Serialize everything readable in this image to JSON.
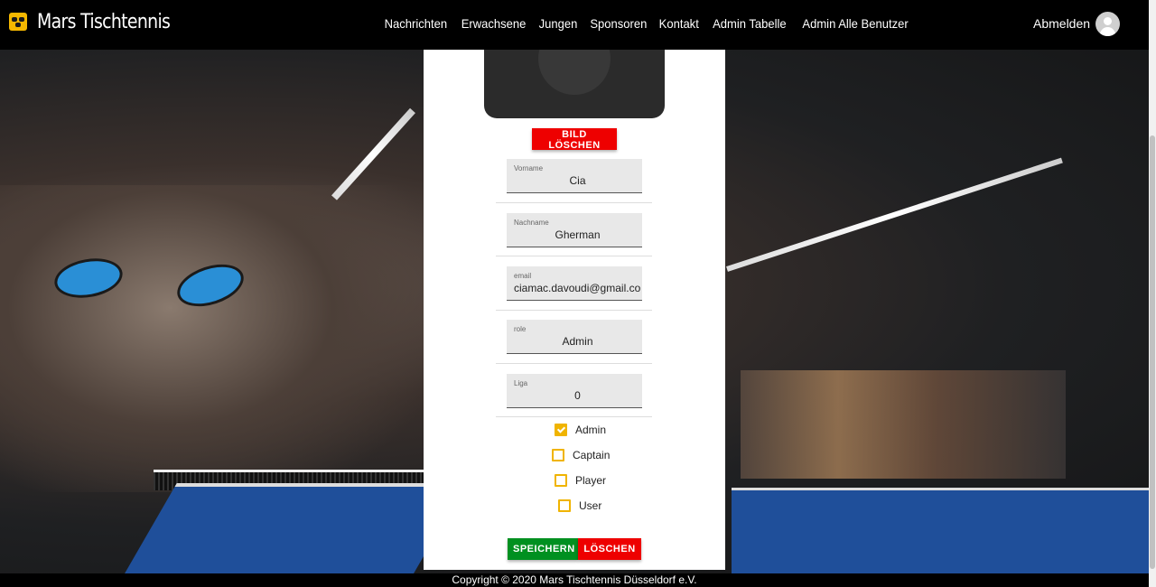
{
  "navbar": {
    "brand": "Mars Tischtennis",
    "links": [
      "Nachrichten",
      "Erwachsene",
      "Jungen",
      "Sponsoren",
      "Kontakt",
      "Admin Tabelle",
      "Admin Alle Benutzer"
    ],
    "logout": "Abmelden",
    "logo_icon": "ping-pong-logo-icon",
    "avatar_icon": "user-avatar-icon"
  },
  "form": {
    "delete_image_label": "Bild löschen",
    "fields": [
      {
        "label": "Vorname",
        "value": "Cia"
      },
      {
        "label": "Nachname",
        "value": "Gherman"
      },
      {
        "label": "email",
        "value": "ciamac.davoudi@gmail.com"
      },
      {
        "label": "role",
        "value": "Admin"
      },
      {
        "label": "Liga",
        "value": "0"
      }
    ],
    "checkboxes": [
      {
        "label": "Admin",
        "checked": true
      },
      {
        "label": "Captain",
        "checked": false
      },
      {
        "label": "Player",
        "checked": false
      },
      {
        "label": "User",
        "checked": false
      }
    ],
    "save_label": "Speichern",
    "delete_label": "Löschen"
  },
  "footer": {
    "text": "Copyright © 2020  Mars Tischtennis Düsseldorf e.V."
  },
  "colors": {
    "navbar": "#000000",
    "accent_checkbox": "#f0b400",
    "danger": "#ee0000",
    "success": "#009020"
  }
}
